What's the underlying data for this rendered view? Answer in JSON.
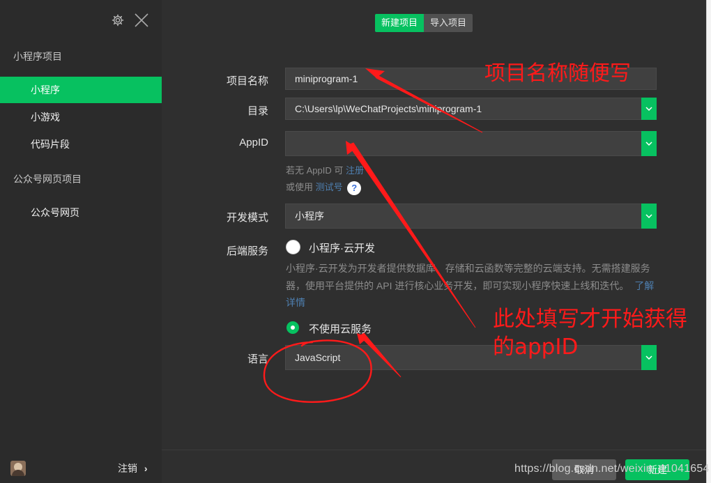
{
  "sidebar": {
    "header_icons": [
      "gear-icon",
      "close-icon"
    ],
    "sections": [
      {
        "title": "小程序项目",
        "items": [
          "小程序",
          "小游戏",
          "代码片段"
        ]
      },
      {
        "title": "公众号网页项目",
        "items": [
          "公众号网页"
        ]
      }
    ],
    "active_item": "小程序",
    "footer": {
      "logout_label": "注销",
      "logout_arrow": "›"
    }
  },
  "tabs": {
    "new_project": "新建项目",
    "import_project": "导入项目"
  },
  "form": {
    "project_name": {
      "label": "项目名称",
      "value": "miniprogram-1"
    },
    "directory": {
      "label": "目录",
      "value": "C:\\Users\\lp\\WeChatProjects\\miniprogram-1"
    },
    "appid": {
      "label": "AppID",
      "value": "",
      "hint_prefix": "若无 AppID 可",
      "hint_link": "注册",
      "hint2_prefix": "或使用",
      "hint2_link": "测试号",
      "help_icon": "?"
    },
    "dev_mode": {
      "label": "开发模式",
      "value": "小程序"
    },
    "backend": {
      "label": "后端服务",
      "option_cloud": "小程序·云开发",
      "cloud_desc": "小程序·云开发为开发者提供数据库、存储和云函数等完整的云端支持。无需搭建服务器，使用平台提供的 API 进行核心业务开发，即可实现小程序快速上线和迭代。",
      "cloud_link": "了解详情",
      "option_none": "不使用云服务",
      "selected": "不使用云服务"
    },
    "language": {
      "label": "语言",
      "value": "JavaScript"
    }
  },
  "footer": {
    "cancel_label": "取消",
    "create_label": "新建"
  },
  "annotations": {
    "note1": "项目名称随便写",
    "note2_line1": "此处填写才开始获得",
    "note2_line2": "的appID",
    "color": "#ff1a1a"
  },
  "watermark": "https://blog.csdn.net/weixin_41041654",
  "colors": {
    "accent": "#07c160",
    "bg": "#2f2f2f",
    "sidebar_bg": "#2b2b2b",
    "field_bg": "#404040",
    "link": "#4e7fb0"
  }
}
